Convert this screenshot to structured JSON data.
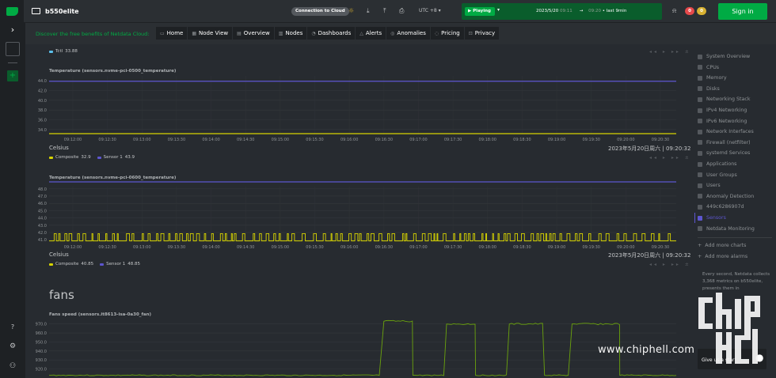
{
  "topbar": {
    "hostname": "b550elite",
    "connection": "Connection to Cloud",
    "timezone": "UTC +8",
    "playing": "Playing",
    "date": "2023/5/20",
    "time_from": "09:11",
    "arrow": "→",
    "time_to": "09:20",
    "last": "• last 9min",
    "badge_red": "0",
    "badge_yellow": "0",
    "signin": "Sign in"
  },
  "nav": {
    "discover": "Discover the free benefits of Netdata Cloud:",
    "tabs": [
      "Home",
      "Node View",
      "Overview",
      "Nodes",
      "Dashboards",
      "Alerts",
      "Anomalies",
      "Pricing",
      "Privacy"
    ]
  },
  "charts": {
    "top_legend": {
      "name": "Tctl",
      "value": "33.88"
    },
    "nvme1": {
      "title": "Temperature (sensors.nvme-pci-0500_temperature)",
      "unit": "Celsius",
      "timestamp": "2023年5月20日周六 | 09:20:32",
      "legend": [
        {
          "name": "Composite",
          "value": "32.9",
          "color": "#d7d400"
        },
        {
          "name": "Sensor 1",
          "value": "43.9",
          "color": "#5d56cf"
        }
      ]
    },
    "nvme2": {
      "title": "Temperature (sensors.nvme-pci-0600_temperature)",
      "unit": "Celsius",
      "timestamp": "2023年5月20日周六 | 09:20:32",
      "legend": [
        {
          "name": "Composite",
          "value": "40.85",
          "color": "#d7d400"
        },
        {
          "name": "Sensor 1",
          "value": "48.85",
          "color": "#5d56cf"
        }
      ]
    },
    "fans_section": "fans",
    "fans": {
      "title": "Fans speed (sensors.it8613-isa-0a30_fan)"
    }
  },
  "chart_data": [
    {
      "type": "line",
      "title": "Temperature (sensors.nvme-pci-0500_temperature)",
      "ylabel": "Celsius",
      "yticks": [
        34.0,
        36.0,
        38.0,
        40.0,
        42.0,
        44.0
      ],
      "ylim": [
        33,
        45
      ],
      "xticks": [
        "09:12:00",
        "09:12:30",
        "09:13:00",
        "09:13:30",
        "09:14:00",
        "09:14:30",
        "09:15:00",
        "09:15:30",
        "09:16:00",
        "09:16:30",
        "09:17:00",
        "09:17:30",
        "09:18:00",
        "09:18:30",
        "09:19:00",
        "09:19:30",
        "09:20:00",
        "09:20:30"
      ],
      "series": [
        {
          "name": "Composite",
          "color": "#d7d400",
          "constant": 32.9
        },
        {
          "name": "Sensor 1",
          "color": "#5d56cf",
          "constant": 43.9
        }
      ]
    },
    {
      "type": "line",
      "title": "Temperature (sensors.nvme-pci-0600_temperature)",
      "ylabel": "Celsius",
      "yticks": [
        41.0,
        42.0,
        43.0,
        44.0,
        45.0,
        46.0,
        47.0,
        48.0
      ],
      "ylim": [
        40.7,
        48.3
      ],
      "xticks": [
        "09:12:00",
        "09:12:30",
        "09:13:00",
        "09:13:30",
        "09:14:00",
        "09:14:30",
        "09:15:00",
        "09:15:30",
        "09:16:00",
        "09:16:30",
        "09:17:00",
        "09:17:30",
        "09:18:00",
        "09:18:30",
        "09:19:00",
        "09:19:30",
        "09:20:00",
        "09:20:30"
      ],
      "series": [
        {
          "name": "Composite",
          "color": "#d7d400",
          "base": 40.85,
          "peak": 41.85
        },
        {
          "name": "Sensor 1",
          "color": "#5d56cf",
          "constant": 48.85
        }
      ]
    },
    {
      "type": "line",
      "title": "Fans speed (sensors.it8613-isa-0a30_fan)",
      "yticks": [
        920.0,
        930.0,
        940.0,
        950.0,
        960.0,
        970.0
      ],
      "ylim": [
        910,
        975
      ],
      "series": [
        {
          "name": "fan",
          "color": "#6ba30d",
          "base": 913,
          "peaks": [
            [
              0.53,
              0.58,
              973
            ],
            [
              0.63,
              0.68,
              970
            ],
            [
              0.73,
              0.79,
              970
            ],
            [
              0.83,
              0.91,
              970
            ]
          ]
        }
      ]
    }
  ],
  "rightnav": {
    "items": [
      "System Overview",
      "CPUs",
      "Memory",
      "Disks",
      "Networking Stack",
      "IPv4 Networking",
      "IPv6 Networking",
      "Network Interfaces",
      "Firewall (netfilter)",
      "systemd Services",
      "Applications",
      "User Groups",
      "Users",
      "Anomaly Detection",
      "449c6286907d",
      "Sensors",
      "Netdata Monitoring"
    ],
    "active_index": 15,
    "add_charts": "Add more charts",
    "add_alarms": "Add more alarms",
    "note": "Every second, Netdata collects 3,368 metrics on b550elite, presents them in",
    "star": "Give us a star!"
  },
  "watermark": {
    "text": "www.chiphell.com"
  },
  "colors": {
    "accent": "#00ab44",
    "yellow_series": "#d7d400",
    "purple_series": "#5d56cf",
    "green_series": "#6ba30d",
    "badge_red": "#e5494b",
    "badge_yellow": "#d8b131"
  }
}
